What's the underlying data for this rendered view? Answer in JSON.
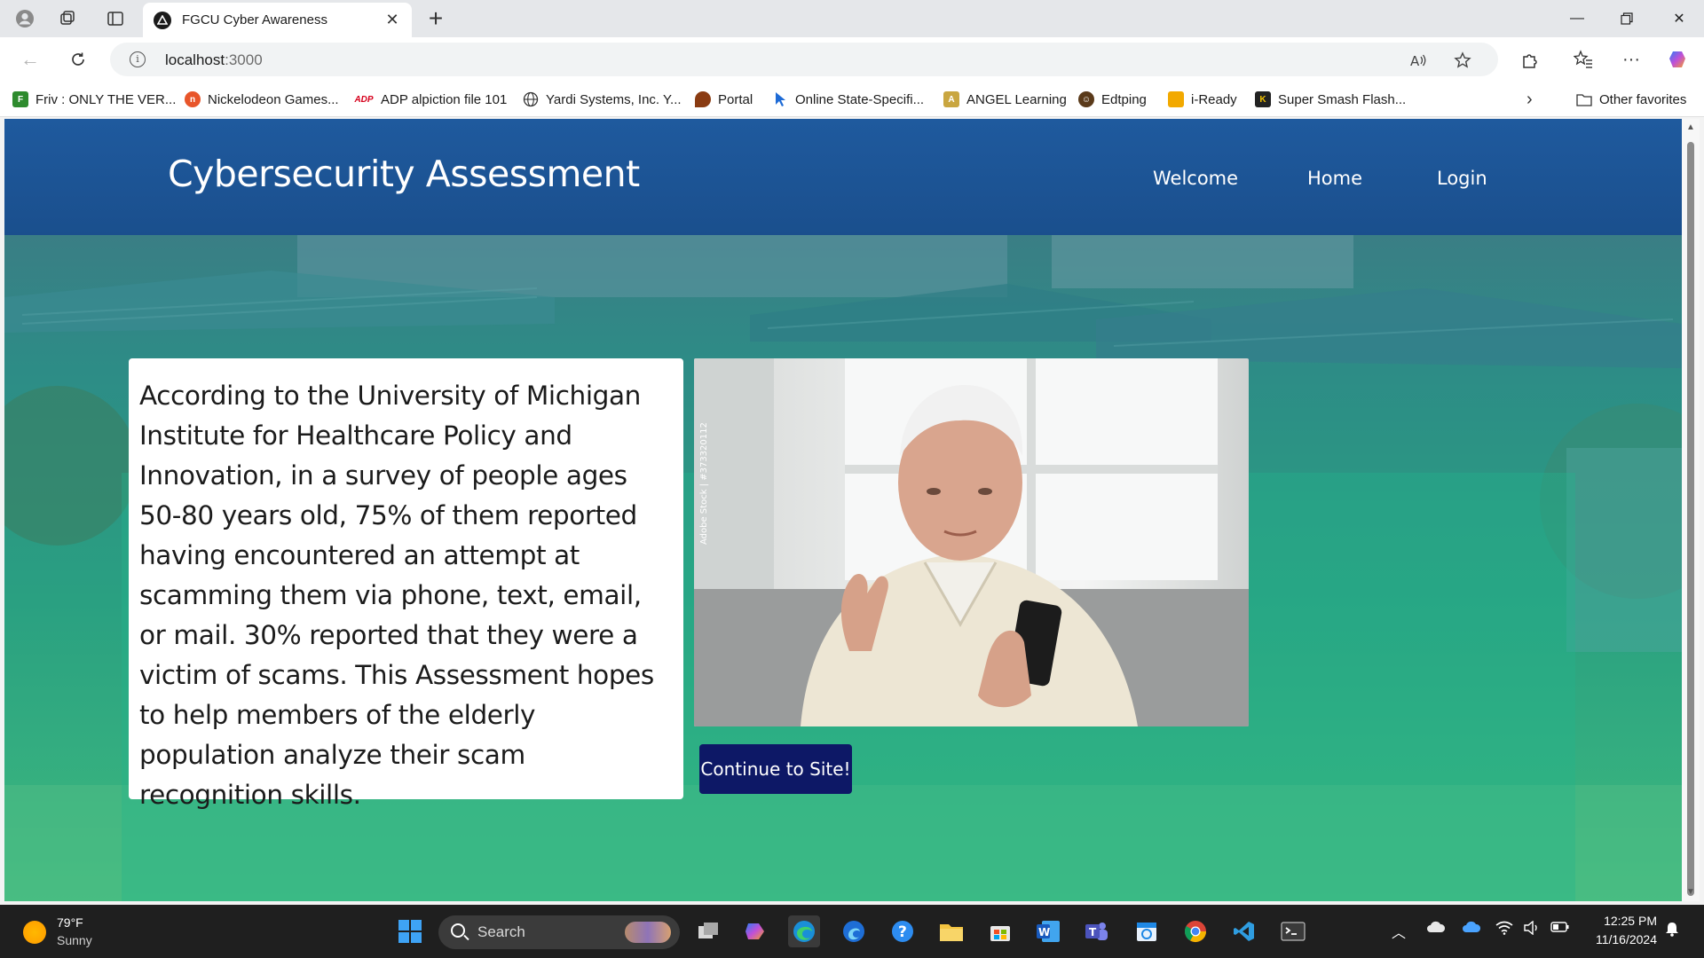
{
  "browser": {
    "tab_title": "FGCU Cyber Awareness",
    "url_host": "localhost",
    "url_port": ":3000",
    "bookmarks": [
      {
        "label": "Friv : ONLY THE VER...",
        "icon": "friv-icon",
        "color": "#2e8b2e"
      },
      {
        "label": "Nickelodeon Games...",
        "icon": "nickelodeon-icon",
        "color": "#e8552a"
      },
      {
        "label": "ADP alpiction file 101",
        "icon": "adp-icon",
        "color": "#d6001c"
      },
      {
        "label": "Yardi Systems, Inc. Y...",
        "icon": "globe-icon",
        "color": "#333333"
      },
      {
        "label": "Portal",
        "icon": "portal-icon",
        "color": "#8a3b12"
      },
      {
        "label": "Online State-Specifi...",
        "icon": "cursor-icon",
        "color": "#1e6bd6"
      },
      {
        "label": "ANGEL Learning",
        "icon": "angel-icon",
        "color": "#c9a640"
      },
      {
        "label": "Edtping",
        "icon": "edtping-icon",
        "color": "#5a3a1a"
      },
      {
        "label": "i-Ready",
        "icon": "iready-icon",
        "color": "#f2a900"
      },
      {
        "label": "Super Smash Flash...",
        "icon": "ssf-icon",
        "color": "#222222"
      }
    ],
    "other_favorites": "Other favorites"
  },
  "site": {
    "title": "Cybersecurity Assessment",
    "nav": [
      "Welcome",
      "Home",
      "Login"
    ],
    "intro_text": "According to the University of Michigan Institute for Healthcare Policy and Innovation, in a survey of people ages 50-80 years old, 75% of them reported having encountered an attempt at scamming them via phone, text, email, or mail. 30% reported that they were a victim of scams. This Assessment hopes to help members of the elderly population analyze their scam recognition skills.",
    "photo_watermark": "Adobe Stock | #373320112",
    "continue_label": "Continue to Site!",
    "colors": {
      "header": "#1a4f8d",
      "button": "#0d1866",
      "hero_overlay": "#2aa081"
    }
  },
  "taskbar": {
    "temperature": "79°F",
    "condition": "Sunny",
    "search_placeholder": "Search",
    "time": "12:25 PM",
    "date": "11/16/2024"
  }
}
